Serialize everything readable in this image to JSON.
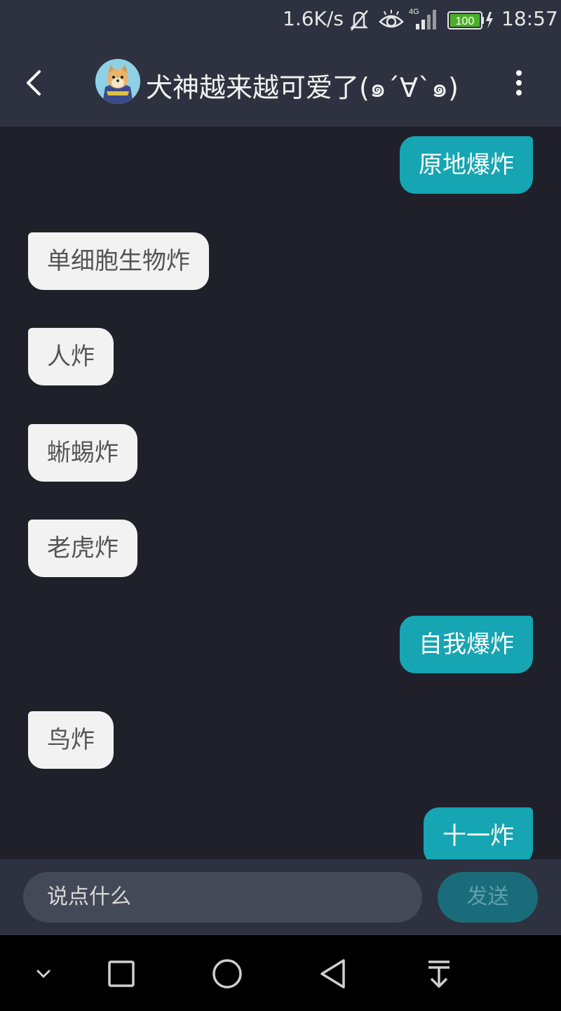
{
  "status_bar": {
    "speed": "1.6K/s",
    "network": "4G",
    "battery": "100",
    "time": "18:57"
  },
  "header": {
    "title": "犬神越来越可爱了(๑´∀`๑)",
    "back_icon": "chevron-left-icon",
    "more_icon": "more-vertical-icon"
  },
  "messages": [
    {
      "side": "out",
      "text": "原地爆炸"
    },
    {
      "side": "in",
      "text": "单细胞生物炸"
    },
    {
      "side": "in",
      "text": "人炸"
    },
    {
      "side": "in",
      "text": "蜥蜴炸"
    },
    {
      "side": "in",
      "text": "老虎炸"
    },
    {
      "side": "out",
      "text": "自我爆炸"
    },
    {
      "side": "in",
      "text": "鸟炸"
    },
    {
      "side": "out",
      "text": "十一炸"
    }
  ],
  "input": {
    "placeholder": "说点什么",
    "send_label": "发送"
  },
  "colors": {
    "background": "#20202a",
    "bar": "#2e3240",
    "outgoing_bubble": "#16a5b3",
    "incoming_bubble": "#f2f2f2",
    "send_button": "#1b6c7a"
  }
}
